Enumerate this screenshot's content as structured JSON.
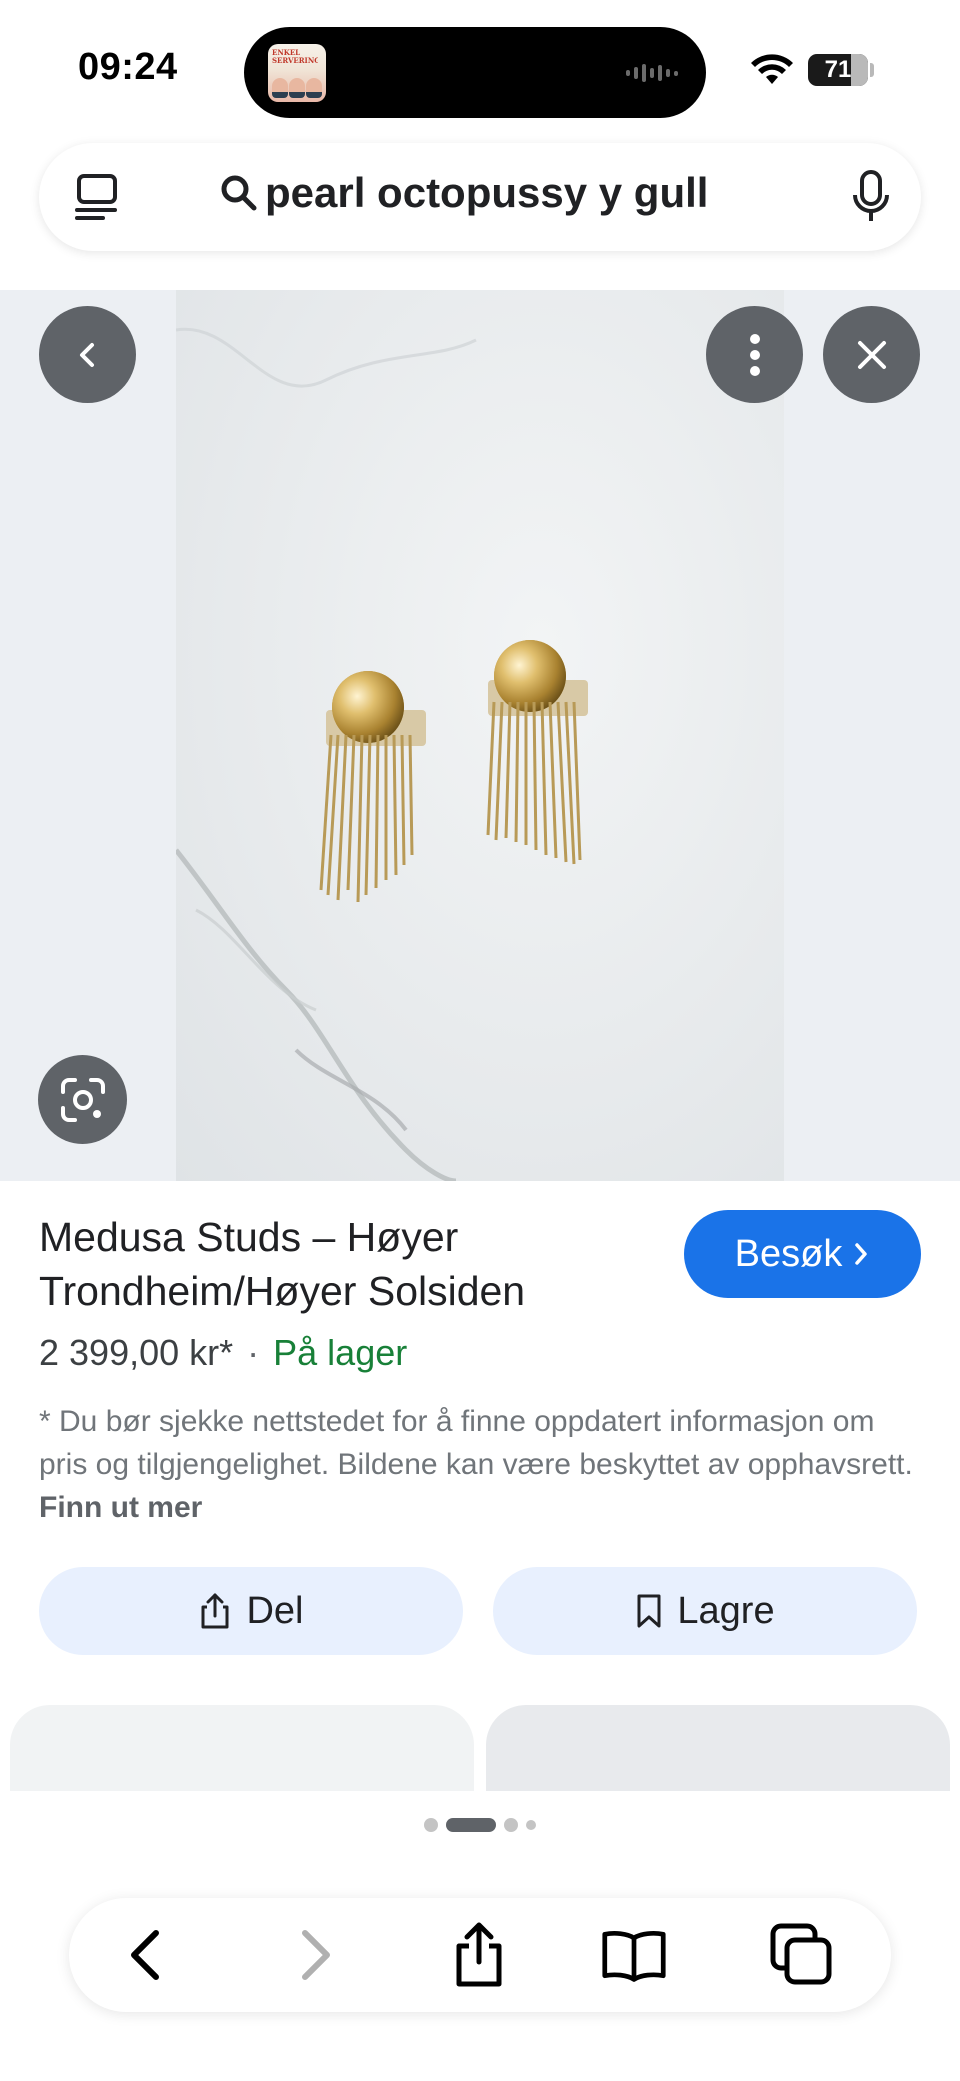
{
  "status_bar": {
    "time": "09:24",
    "battery_level": "71",
    "battery_fraction": 0.71,
    "island_art_text": "ENKEL SERVERING"
  },
  "search": {
    "query": "pearl octopussy y gull",
    "tabs_icon": "tabs-icon",
    "search_icon": "search-icon",
    "mic_icon": "mic-icon"
  },
  "image_viewer": {
    "back_icon": "chevron-left-icon",
    "more_icon": "more-vert-icon",
    "close_icon": "close-icon",
    "lens_icon": "lens-icon",
    "image_alt": "Gold dome earrings with chain fringe on marble"
  },
  "product": {
    "title": "Medusa Studs – Høyer Trondheim/Høyer Solsiden",
    "visit_label": "Besøk",
    "price": "2 399,00 kr*",
    "separator": "·",
    "stock": "På lager",
    "disclaimer": "* Du bør sjekke nettstedet for å finne oppdatert informasjon om pris og tilgjengelighet. Bildene kan være beskyttet av opphavsrett.",
    "learn_more": "Finn ut mer"
  },
  "actions": {
    "share_label": "Del",
    "save_label": "Lagre"
  },
  "pager": {
    "total": 4,
    "active_index": 1
  },
  "toolbar": {
    "items": [
      "back-icon",
      "forward-icon",
      "share-icon",
      "bookmarks-icon",
      "tabs-icon"
    ]
  },
  "colors": {
    "accent": "#1a73e8",
    "stock_green": "#188038",
    "action_bg": "#e8f0fe",
    "overlay_btn": "#5f6368"
  }
}
